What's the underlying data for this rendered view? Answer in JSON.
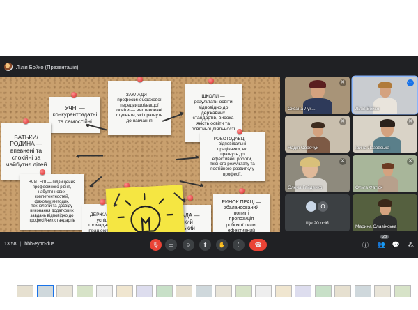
{
  "presenter": {
    "label": "Лілія Бойко (Презентація)"
  },
  "slide": {
    "notes": [
      {
        "text": "УЧНІ —\nконкурентоздатні\nта самостійні"
      },
      {
        "text": "ЗАКЛАДИ —\nпрофесійної/фахової\nпередвищої/вищої\nосвіти — вмотивовані\nстуденти, які прагнуть\nдо навчання"
      },
      {
        "text": "ШКОЛИ —\nрезультати освіти\nвідповідно до\nдержавних\nстандартів, висока\nякість освіти та\nосвітньої діяльності"
      },
      {
        "text": "БАТЬКИ/\nРОДИНА —\nвпевнені та\nспокійні за\nмайбутнє дітей"
      },
      {
        "text": "РОБОТОДАВЦІ —\nвідповідальні\nпрацівники, які\nпрагнуть до\nефективної роботи,\nякісного результату та\nпостійного розвитку у\nпрофесії."
      },
      {
        "text": "ВЧИТЕЛІ — підвищення\nпрофесійного рівня,\nнабуття нових\nкомпетентностей,\nфахових методик,\nтехнологій та досвіду\nвиконання додаткових\nзавдань відповідно до\nпрофесійних стандартів"
      },
      {
        "text": "ДЕРЖАВА —\nуспішні\nгромадяни, які\nпрацюють для\nвласного\nдобробуту та\nсталого розвитку\nсвоєї країни."
      },
      {
        "text": "ГРОМАДА —\nвисокий\nлюдський\nпотенціал,\nсоціальноеконом\nчний розвиток."
      },
      {
        "text": "РИНОК ПРАЦІ —\nзбалансований\nпопит і\nпропозиція\nробочої сили,\nефективний\nрозвиток."
      }
    ]
  },
  "participants": [
    {
      "name": "Оксана Лук...",
      "mic": "muted"
    },
    {
      "name": "Лілія Бойко",
      "mic": "on"
    },
    {
      "name": "Надія Сорочук",
      "mic": "muted"
    },
    {
      "name": "Ірина Лазовська",
      "mic": "muted"
    },
    {
      "name": "Олена Гайденко",
      "mic": "muted"
    },
    {
      "name": "Ольга Фатюк",
      "mic": "muted"
    },
    {
      "name": "Ще 20 осіб",
      "mic": "none"
    },
    {
      "name": "Марина Славінська",
      "mic": "none"
    }
  ],
  "more_avatar_letter": "О",
  "bottom_bar": {
    "time": "13:58",
    "meeting_code": "hbb-eyhc-due",
    "people_count": "28"
  },
  "colors": {
    "bg": "#202124",
    "end_call": "#ea4335",
    "accent": "#1a73e8",
    "sticky": "#f5e642"
  },
  "taskbar": {
    "thumbnail_count": 20
  }
}
